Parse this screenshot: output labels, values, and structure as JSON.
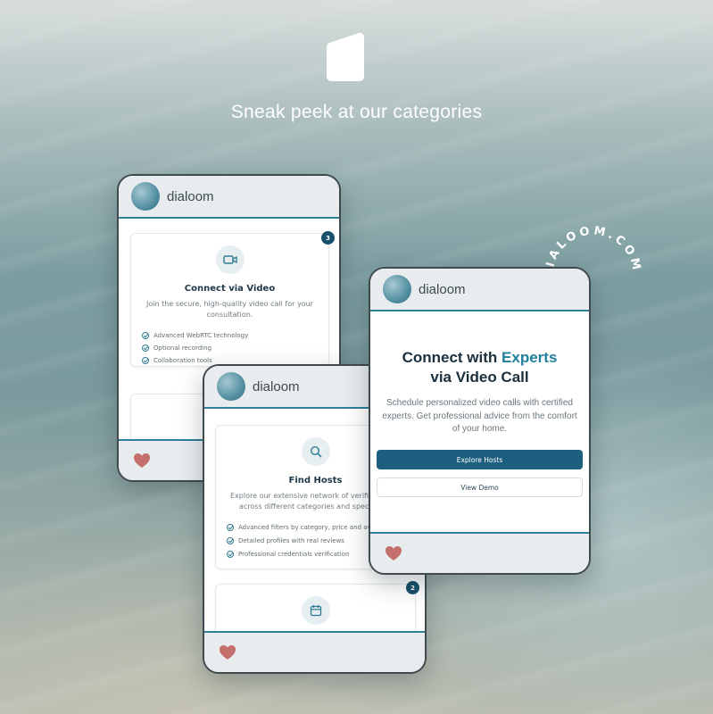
{
  "page": {
    "tagline": "Sneak peek at our categories",
    "circular_text": "DIALOOM.COM",
    "colors": {
      "accent": "#1f7f9c",
      "primary_button": "#1c5f7e",
      "header_border": "#2e7f97",
      "heart": "#c46e6e"
    }
  },
  "phone_video": {
    "brand": "dialoom",
    "badge": "3",
    "card": {
      "icon": "video-camera-icon",
      "title": "Connect via Video",
      "description": "Join the secure, high-quality video call for your consultation.",
      "features": [
        "Advanced WebRTC technology",
        "Optional recording",
        "Collaboration tools"
      ]
    },
    "footer_icon": "heart-icon"
  },
  "phone_hosts": {
    "brand": "dialoom",
    "badge": "2",
    "card": {
      "icon": "search-icon",
      "title": "Find Hosts",
      "description_line1": "Explore our extensive network of verified",
      "description_line2": "across different categories and speci",
      "features": [
        "Advanced filters by category, price and ava",
        "Detailed profiles with real reviews",
        "Professional credentials verification"
      ]
    },
    "next_card_icon": "calendar-icon",
    "footer_icon": "heart-icon"
  },
  "phone_hero": {
    "brand": "dialoom",
    "title_part1": "Connect with",
    "title_accent": "Experts",
    "title_line2": "via Video Call",
    "description": "Schedule personalized video calls with certified experts. Get professional advice from the comfort of your home.",
    "primary_button": "Explore Hosts",
    "secondary_button": "View Demo",
    "footer_icon": "heart-icon"
  }
}
